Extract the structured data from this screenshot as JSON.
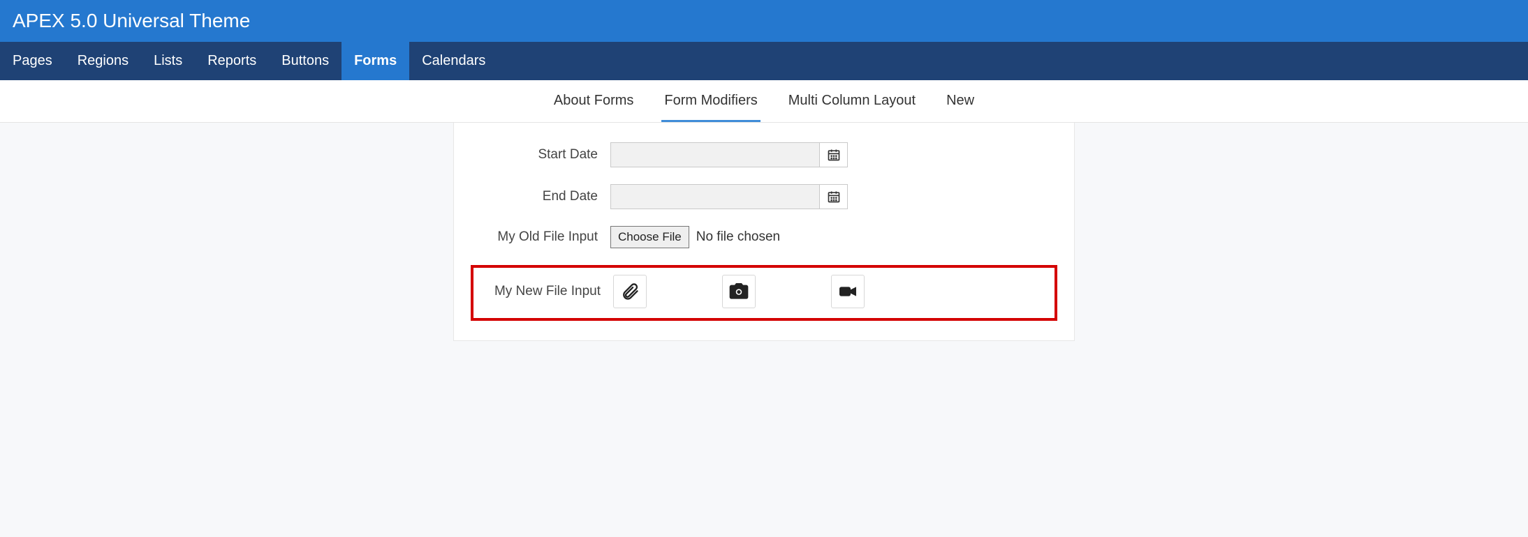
{
  "header": {
    "title": "APEX 5.0 Universal Theme"
  },
  "main_nav": {
    "items": [
      {
        "label": "Pages",
        "active": false
      },
      {
        "label": "Regions",
        "active": false
      },
      {
        "label": "Lists",
        "active": false
      },
      {
        "label": "Reports",
        "active": false
      },
      {
        "label": "Buttons",
        "active": false
      },
      {
        "label": "Forms",
        "active": true
      },
      {
        "label": "Calendars",
        "active": false
      }
    ]
  },
  "sub_nav": {
    "items": [
      {
        "label": "About Forms",
        "active": false
      },
      {
        "label": "Form Modifiers",
        "active": true
      },
      {
        "label": "Multi Column Layout",
        "active": false
      },
      {
        "label": "New",
        "active": false
      }
    ]
  },
  "form": {
    "start_date": {
      "label": "Start Date",
      "value": ""
    },
    "end_date": {
      "label": "End Date",
      "value": ""
    },
    "old_file": {
      "label": "My Old File Input",
      "button": "Choose File",
      "status": "No file chosen"
    },
    "new_file": {
      "label": "My New File Input"
    }
  }
}
